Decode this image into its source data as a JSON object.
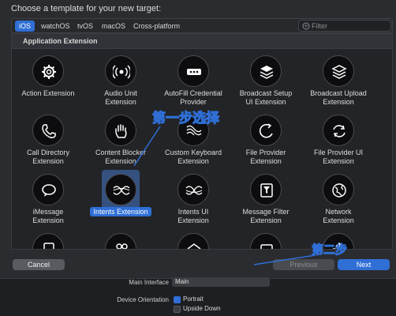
{
  "dialog": {
    "title": "Choose a template for your new target:",
    "tabs": [
      "iOS",
      "watchOS",
      "tvOS",
      "macOS",
      "Cross-platform"
    ],
    "active_tab": "iOS",
    "filter_placeholder": "Filter"
  },
  "section": {
    "header": "Application Extension"
  },
  "templates": [
    {
      "label": "Action Extension",
      "icon": "gear-icon"
    },
    {
      "label": "Audio Unit\nExtension",
      "icon": "audio-unit-icon"
    },
    {
      "label": "AutoFill Credential\nProvider",
      "icon": "autofill-dots-icon"
    },
    {
      "label": "Broadcast Setup\nUI Extension",
      "icon": "broadcast-setup-icon"
    },
    {
      "label": "Broadcast Upload\nExtension",
      "icon": "broadcast-upload-icon"
    },
    {
      "label": "Call Directory\nExtension",
      "icon": "phone-icon"
    },
    {
      "label": "Content Blocker\nExtension",
      "icon": "hand-icon"
    },
    {
      "label": "Custom Keyboard\nExtension",
      "icon": "keyboard-icon"
    },
    {
      "label": "File Provider\nExtension",
      "icon": "file-provider-icon"
    },
    {
      "label": "File Provider UI\nExtension",
      "icon": "sync-icon"
    },
    {
      "label": "iMessage\nExtension",
      "icon": "speech-bubble-icon"
    },
    {
      "label": "Intents Extension",
      "icon": "intents-wave-icon"
    },
    {
      "label": "Intents UI\nExtension",
      "icon": "intents-ui-wave-icon"
    },
    {
      "label": "Message Filter\nExtension",
      "icon": "message-filter-icon"
    },
    {
      "label": "Network\nExtension",
      "icon": "network-globe-icon"
    }
  ],
  "selected_template": "Intents Extension",
  "buttons": {
    "cancel": "Cancel",
    "previous": "Previous",
    "next": "Next"
  },
  "annotations": {
    "step1": "第一步选择",
    "step2": "第二步"
  },
  "background_form": {
    "main_interface_label": "Main Interface",
    "main_interface_value": "Main",
    "device_orientation_label": "Device Orientation",
    "orientation_options": [
      {
        "label": "Portrait",
        "checked": true
      },
      {
        "label": "Upside Down",
        "checked": false
      }
    ]
  },
  "colors": {
    "accent": "#2f6fd6",
    "sheet": "#2b2c30",
    "panel": "#232427"
  }
}
